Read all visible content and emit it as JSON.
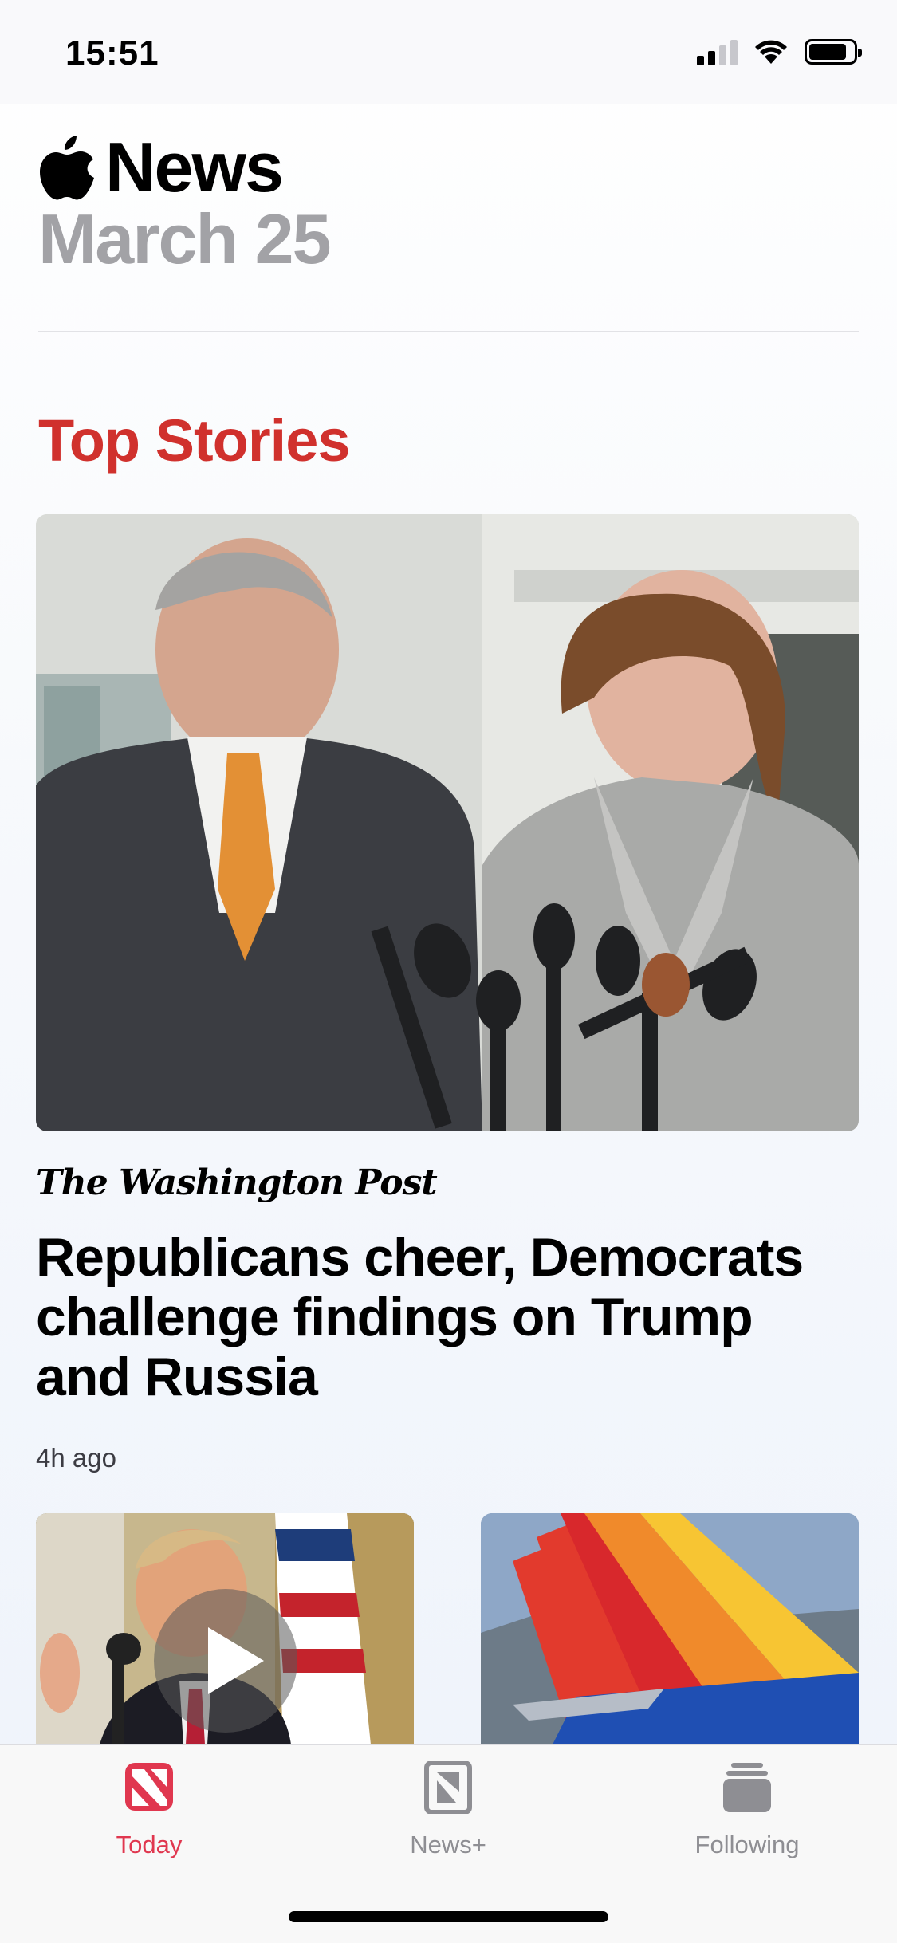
{
  "status_bar": {
    "time": "15:51",
    "battery_level": 0.8
  },
  "header": {
    "app_name": "News",
    "date": "March 25"
  },
  "section": {
    "title": "Top Stories"
  },
  "top_story": {
    "source": "The Washington Post",
    "headline": "Republicans cheer, Democrats challenge findings on Trump and Russia",
    "time_ago": "4h ago"
  },
  "tabs": [
    {
      "label": "Today",
      "icon": "today-news-icon",
      "active": true
    },
    {
      "label": "News+",
      "icon": "news-plus-icon",
      "active": false
    },
    {
      "label": "Following",
      "icon": "following-icon",
      "active": false
    }
  ],
  "colors": {
    "accent_red": "#d0312d",
    "tab_active": "#e0374f",
    "date_gray": "#a2a2a6"
  }
}
